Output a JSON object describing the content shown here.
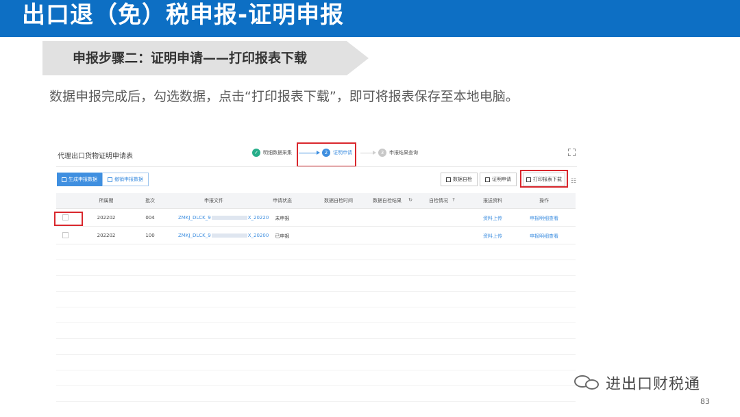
{
  "slide": {
    "title": "出口退（免）税申报-证明申报",
    "step_banner": "申报步骤二：证明申请——打印报表下载",
    "description": "数据申报完成后，勾选数据，点击“打印报表下载”，即可将报表保存至本地电脑。",
    "watermark": "进出口财税通",
    "watermark_icon": "wechat-icon",
    "page_number": "83",
    "colors": {
      "title_bar": "#0d6fc4",
      "highlight": "#d9262c",
      "accent": "#3f8fe0"
    }
  },
  "app": {
    "page_title": "代理出口货物证明申请表",
    "steps": [
      {
        "num": "✓",
        "label": "明细数据采集",
        "state": "done"
      },
      {
        "num": "2",
        "label": "证明申请",
        "state": "current"
      },
      {
        "num": "3",
        "label": "申报结果查询",
        "state": "todo"
      }
    ],
    "toolbar": {
      "generate": "生成申报数据",
      "revoke": "撤销申报数据",
      "self_check": "数据自检",
      "apply": "证明申请",
      "print_download": "打印报表下载"
    },
    "table": {
      "columns": [
        "所属期",
        "批次",
        "申报文件",
        "申请状态",
        "数据自检时间",
        "数据自检结果",
        "自检情况",
        "报送资料",
        "操作"
      ],
      "rows": [
        {
          "period": "202202",
          "batch": "004",
          "file_prefix": "ZMKJ_DLCK_9",
          "file_suffix": "X_20220",
          "status": "未申报",
          "material": "资料上传",
          "action": "申报明细查看"
        },
        {
          "period": "202202",
          "batch": "100",
          "file_prefix": "ZMKJ_DLCK_9",
          "file_suffix": "X_20200",
          "status": "已申报",
          "material": "资料上传",
          "action": "申报明细查看"
        }
      ]
    }
  }
}
